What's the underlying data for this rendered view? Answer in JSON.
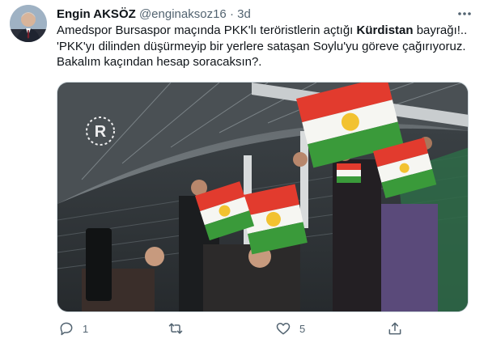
{
  "tweet": {
    "author_name": "Engin AKSÖZ",
    "handle": "@enginaksoz16",
    "separator": "·",
    "time": "3d",
    "text_parts": {
      "p1_before": "Amedspor Bursaspor maçında PKK'lı teröristlerin açtığı ",
      "p1_bold": "Kürdistan",
      "p1_after": " bayrağı!..",
      "p2": "'PKK'yı dilinden düşürmeyip bir yerlere sataşan Soylu'yu göreve çağırıyoruz.",
      "p3": "Bakalım kaçından hesap soracaksın?."
    },
    "media": {
      "description_icon": "video-still-icon",
      "watermark_icon": "rudaw-logo-icon"
    }
  },
  "actions": {
    "reply_count": "1",
    "retweet_count": "",
    "like_count": "5",
    "share_count": ""
  },
  "colors": {
    "text": "#0f1419",
    "secondary": "#536471",
    "flag_red": "#e23b2e",
    "flag_green": "#3a9a3a",
    "flag_sun": "#f2c230"
  }
}
